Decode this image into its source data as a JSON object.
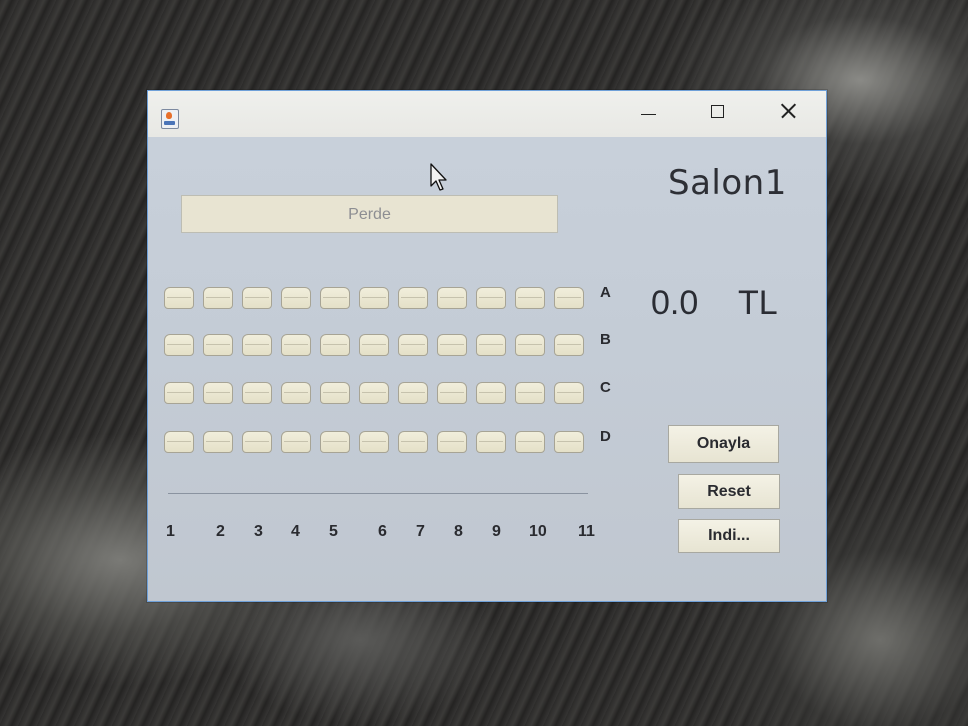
{
  "window": {
    "app_icon": "java-coffee-cup-icon",
    "controls": {
      "minimize": "minimize-icon",
      "maximize": "maximize-icon",
      "close": "close-icon"
    }
  },
  "salon_title": "Salon1",
  "screen_label": "Perde",
  "price": {
    "value": "0.0",
    "unit": "TL"
  },
  "rows": [
    "A",
    "B",
    "C",
    "D"
  ],
  "columns": [
    "1",
    "2",
    "3",
    "4",
    "5",
    "6",
    "7",
    "8",
    "9",
    "10",
    "11"
  ],
  "buttons": {
    "confirm": "Onayla",
    "reset": "Reset",
    "download": "Indi..."
  },
  "colors": {
    "window_bg": "#c4ccd6",
    "seat": "#ebe7d2",
    "window_border": "#6fa0d8"
  }
}
